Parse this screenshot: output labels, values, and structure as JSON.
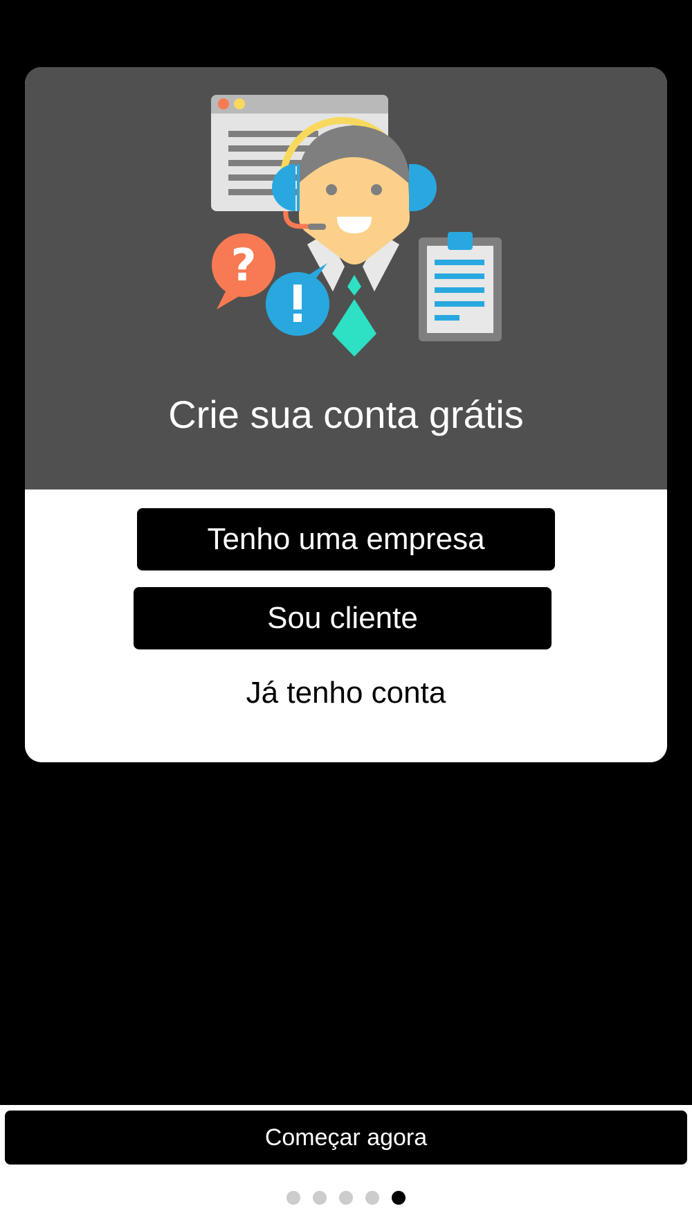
{
  "onboarding": {
    "headline": "Crie sua conta grátis",
    "buttons": {
      "company": "Tenho uma empresa",
      "client": "Sou cliente"
    },
    "login_link": "Já tenho conta"
  },
  "footer": {
    "start_button": "Começar agora",
    "pagination": {
      "total_pages": 5,
      "active_page": 5
    }
  },
  "colors": {
    "page_background": "#000000",
    "card_header": "#505050",
    "card_body": "#ffffff",
    "button": "#000000",
    "dot_inactive": "#cccccc",
    "dot_active": "#000000",
    "illustration_blue": "#29a8e0",
    "illustration_orange": "#f87a52",
    "illustration_yellow": "#f8d95e",
    "illustration_teal": "#2ee0c4"
  },
  "illustration": {
    "icon": "customer-support-agent-icon",
    "elements": [
      "browser-window-icon",
      "headset-icon",
      "question-bubble-icon",
      "exclamation-bubble-icon",
      "clipboard-icon"
    ]
  }
}
